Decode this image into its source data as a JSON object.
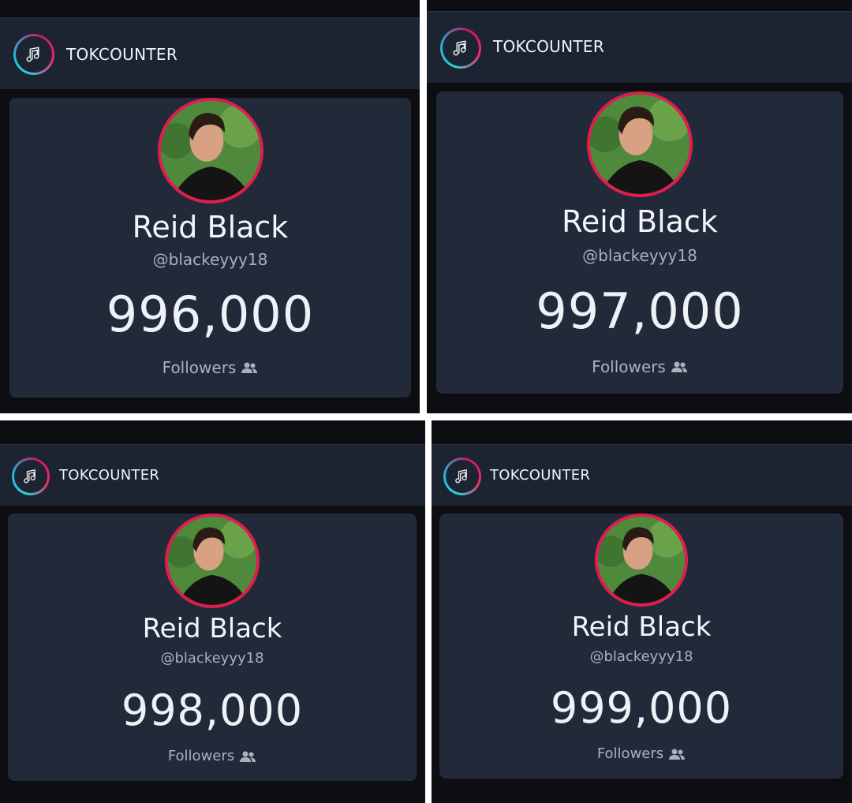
{
  "colors": {
    "app_bar": "#1c2331",
    "card": "#222a39",
    "avatar_ring": "#e11d4f",
    "logo_gradient": [
      "#25d6e0",
      "#ee2a6a"
    ]
  },
  "panels": [
    {
      "brand": "TOKCOUNTER",
      "name": "Reid Black",
      "handle": "@blackeyyy18",
      "count": "996,000",
      "followers_label": "Followers",
      "followers_icon": "users-icon"
    },
    {
      "brand": "TOKCOUNTER",
      "name": "Reid Black",
      "handle": "@blackeyyy18",
      "count": "997,000",
      "followers_label": "Followers",
      "followers_icon": "users-icon"
    },
    {
      "brand": "TOKCOUNTER",
      "name": "Reid Black",
      "handle": "@blackeyyy18",
      "count": "998,000",
      "followers_label": "Followers",
      "followers_icon": "users-icon"
    },
    {
      "brand": "TOKCOUNTER",
      "name": "Reid Black",
      "handle": "@blackeyyy18",
      "count": "999,000",
      "followers_label": "Followers",
      "followers_icon": "users-icon"
    }
  ]
}
